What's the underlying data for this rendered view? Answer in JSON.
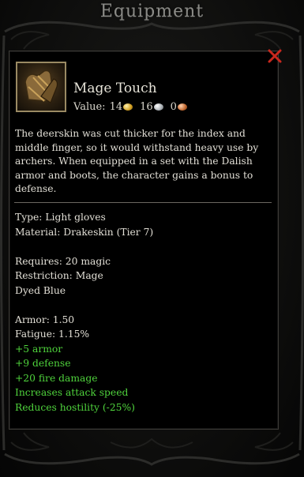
{
  "window": {
    "title": "Equipment"
  },
  "item": {
    "name": "Mage Touch",
    "icon": "leather-gloves-icon",
    "value_label": "Value:",
    "value_gold": "14",
    "value_silver": "16",
    "value_copper": "0",
    "description": "The deerskin was cut thicker for the index and middle finger, so it would withstand heavy use by archers. When equipped in a set with the Dalish armor and boots, the character gains a bonus to defense.",
    "type": "Type: Light gloves",
    "material": "Material: Drakeskin (Tier 7)",
    "requires": "Requires: 20 magic",
    "restriction": "Restriction: Mage",
    "dyed": "Dyed Blue",
    "armor": "Armor: 1.50",
    "fatigue": "Fatigue: 1.15%",
    "bonuses": [
      "+5 armor",
      "+9 defense",
      "+20 fire damage",
      "Increases attack speed",
      "Reduces hostility (-25%)"
    ]
  },
  "colors": {
    "bonus_text": "#4fd33c",
    "close_x": "#c8281e",
    "item_border": "#9a8a63"
  }
}
